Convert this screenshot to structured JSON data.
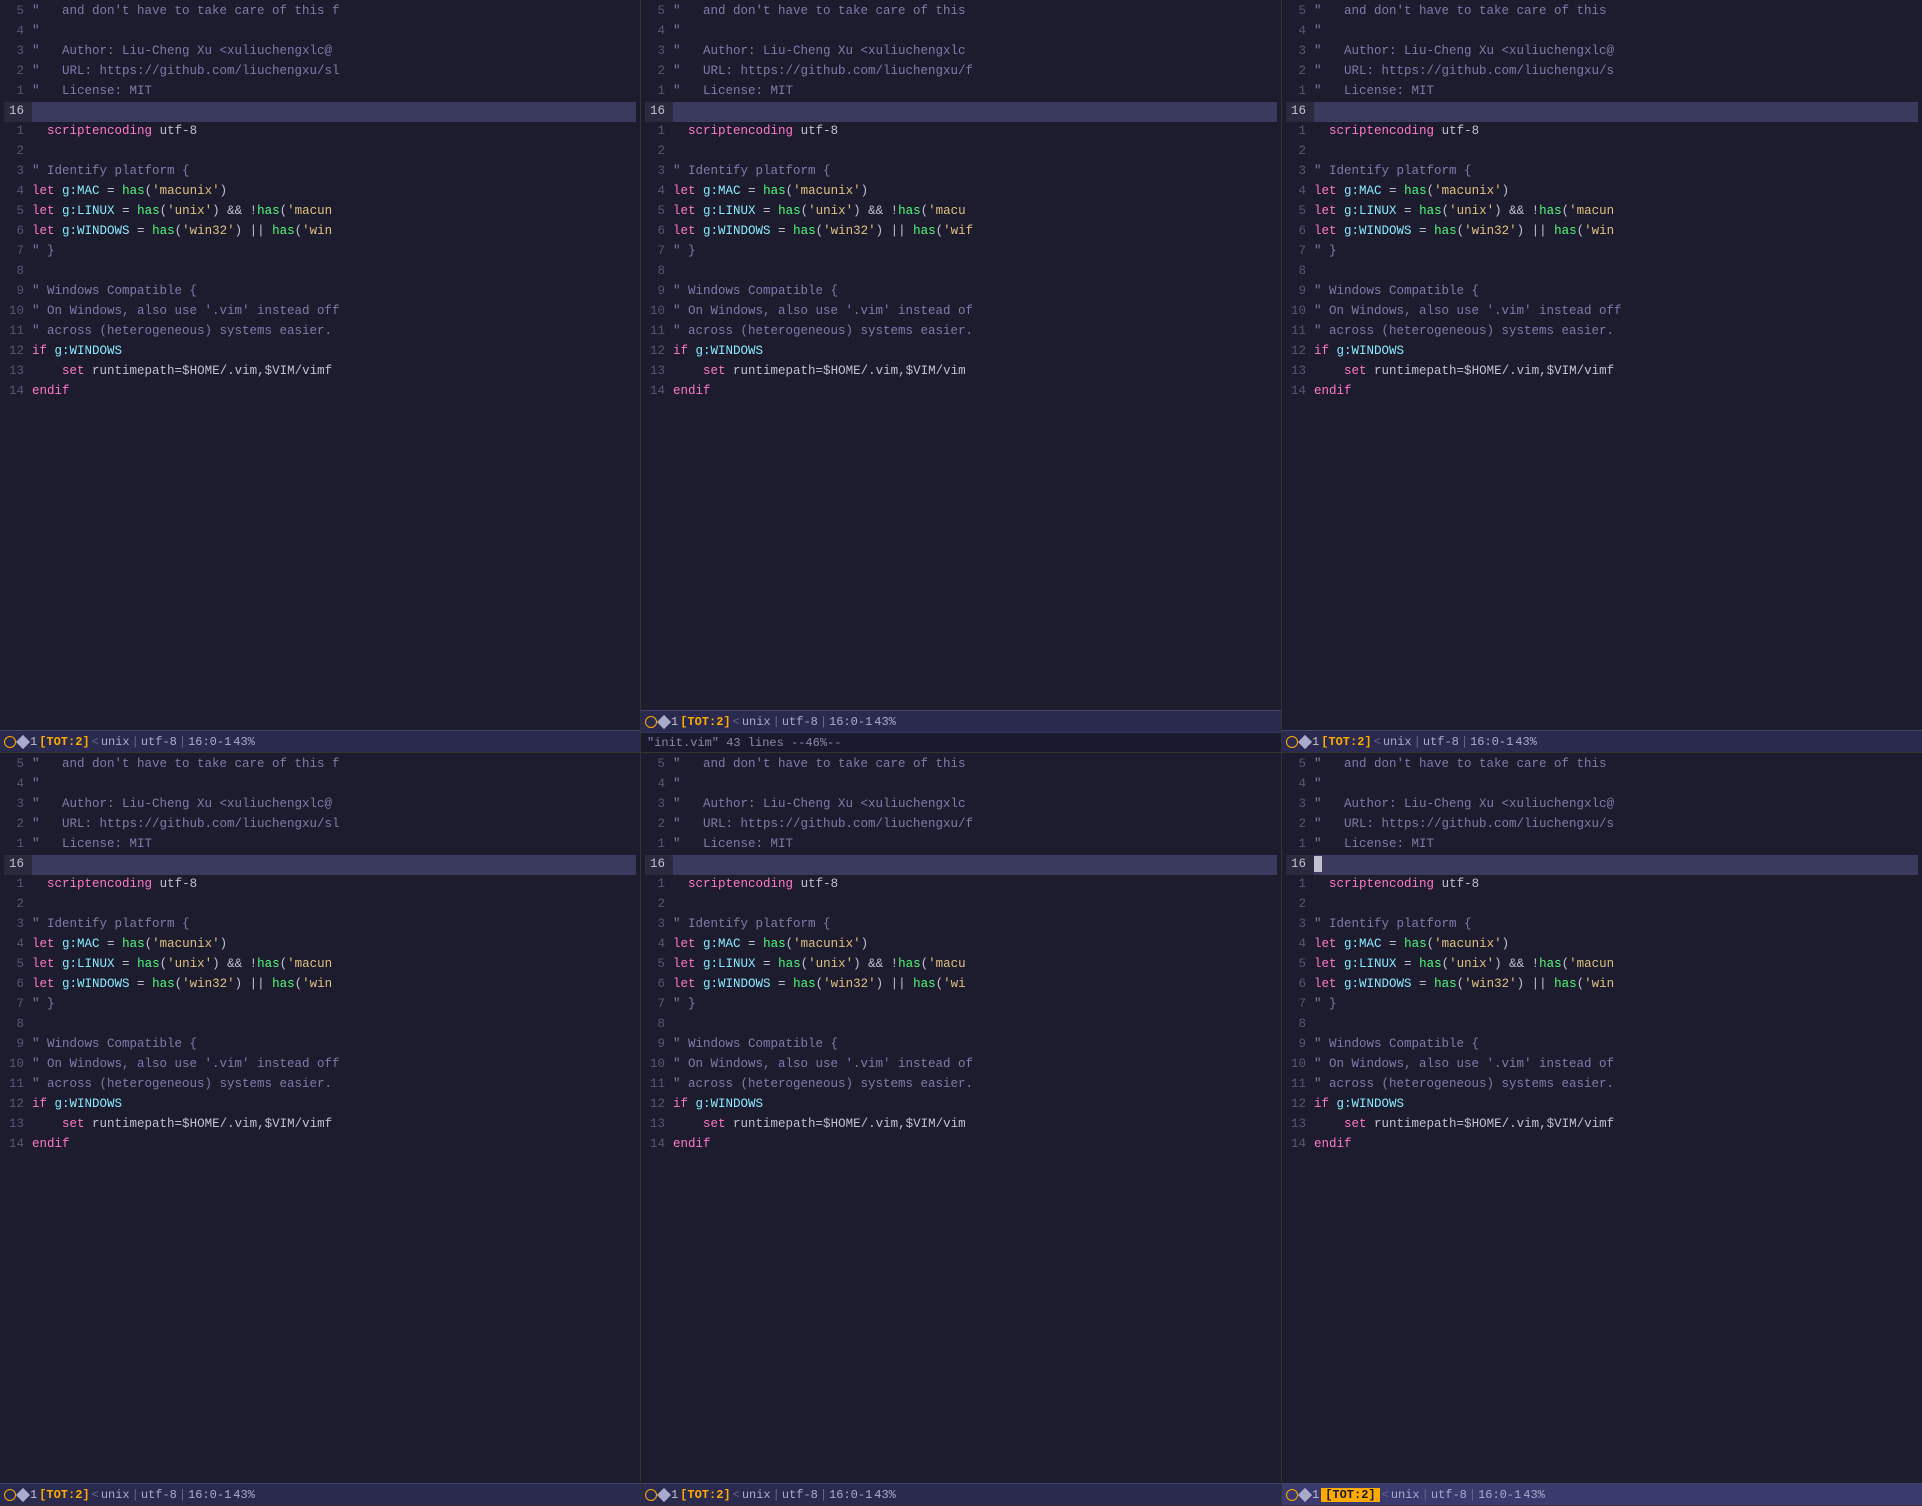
{
  "colors": {
    "bg": "#1c1c2e",
    "linenum": "#555577",
    "comment": "#7c7caa",
    "string": "#e0c080",
    "keyword": "#ff79c6",
    "function": "#50fa7b",
    "variable": "#8be9fd",
    "plain": "#c0c0d0",
    "highlight_line": "#3a3a5e"
  },
  "status": {
    "circle": "○",
    "diamond": "◆",
    "num": "1",
    "tot": "[TOT:2]",
    "sep1": "<",
    "type": "unix",
    "sep2": "|",
    "encoding": "utf-8",
    "sep3": "|",
    "position": "16:0-1",
    "sep4": "43%"
  },
  "bottom_msg": "\"init.vim\" 43 lines --46%--",
  "panes": [
    {
      "id": "top-left",
      "show_bottom": false
    },
    {
      "id": "top-mid",
      "show_bottom": true
    },
    {
      "id": "top-right",
      "show_bottom": false
    },
    {
      "id": "bot-left",
      "show_bottom": false
    },
    {
      "id": "bot-mid",
      "show_bottom": false
    },
    {
      "id": "bot-right",
      "show_bottom": false,
      "has_cursor": true
    }
  ]
}
